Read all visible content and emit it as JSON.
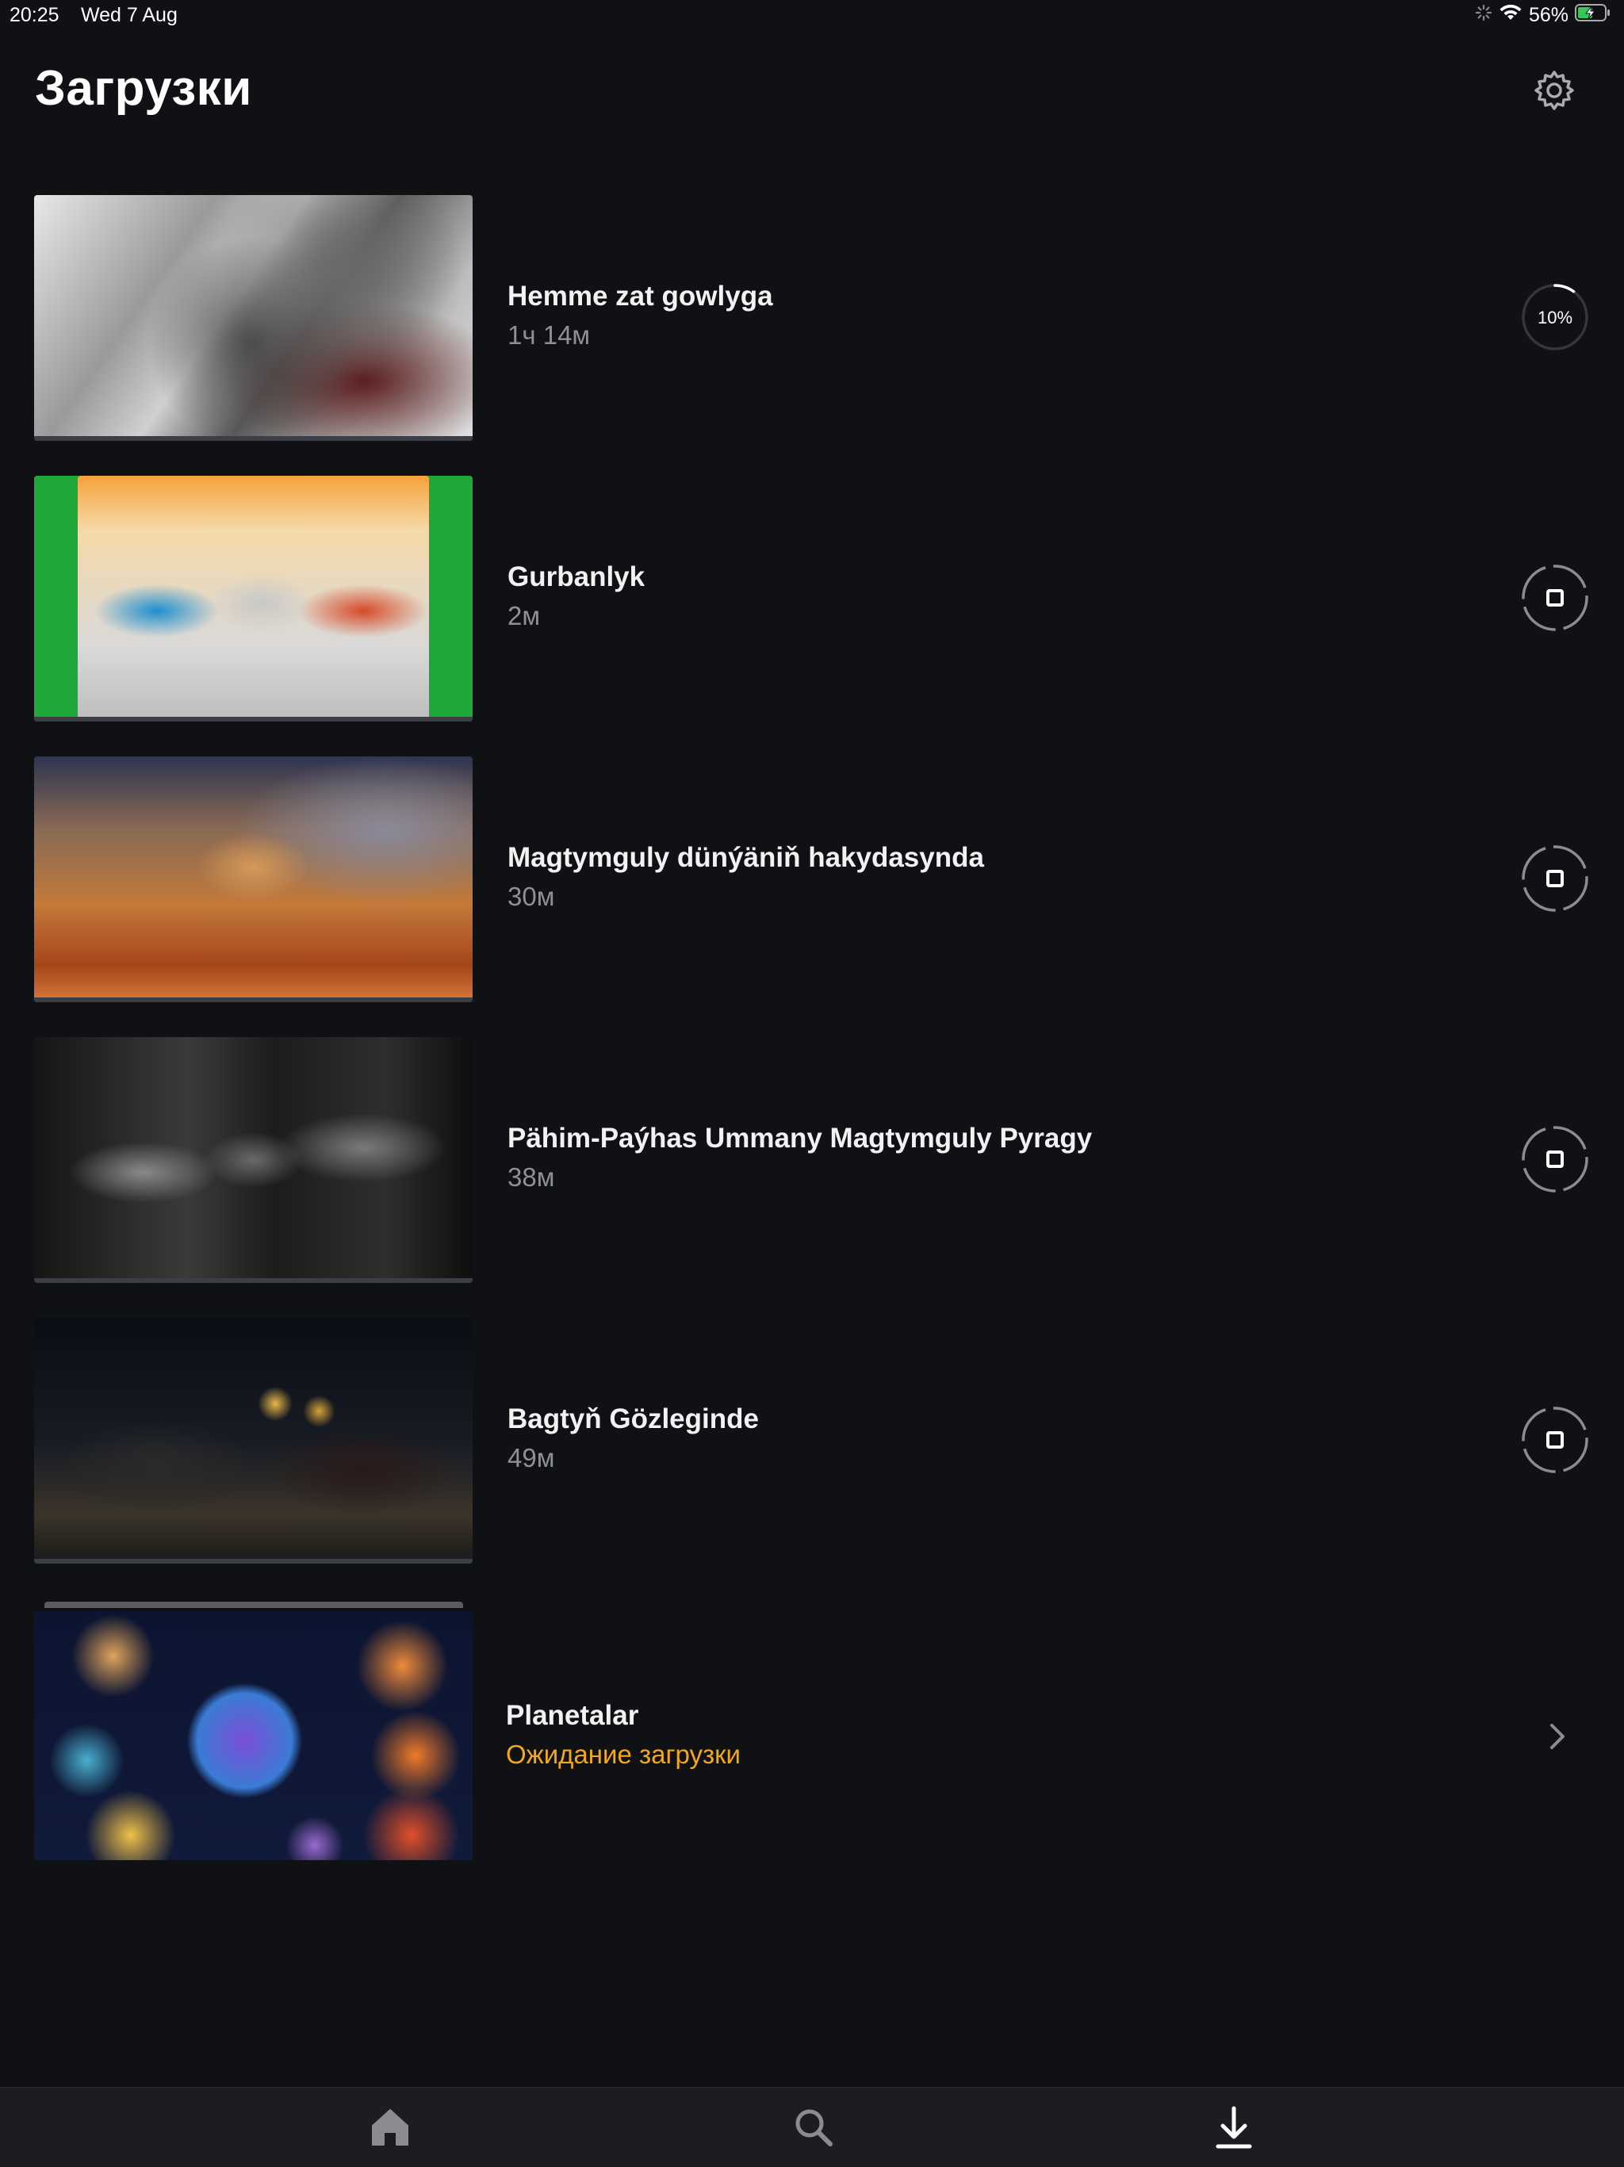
{
  "status_bar": {
    "time": "20:25",
    "date": "Wed 7 Aug",
    "battery": "56%",
    "battery_level": 0.56,
    "icons": [
      "activity-spinner-icon",
      "wifi-icon",
      "battery-charging-icon"
    ]
  },
  "header": {
    "title": "Загрузки",
    "settings_icon": "gear-icon"
  },
  "downloads": [
    {
      "title": "Hemme zat gowlyga",
      "subtitle": "1ч 14м",
      "status": "downloading",
      "progress_label": "10%",
      "progress": 0.1,
      "action_icon": "progress-ring-icon"
    },
    {
      "title": "Gurbanlyk",
      "subtitle": "2м",
      "status": "queued",
      "action_icon": "stop-download-icon"
    },
    {
      "title": "Magtymguly dünýäniň hakydasynda",
      "subtitle": "30м",
      "status": "queued",
      "action_icon": "stop-download-icon"
    },
    {
      "title": "Pähim-Paýhas Ummany Magtymguly Pyragy",
      "subtitle": "38м",
      "status": "queued",
      "action_icon": "stop-download-icon"
    },
    {
      "title": "Bagtyň Gözleginde",
      "subtitle": "49м",
      "status": "queued",
      "action_icon": "stop-download-icon"
    },
    {
      "title": "Planetalar",
      "subtitle": "Ожидание загрузки",
      "status": "waiting",
      "action_icon": "chevron-right-icon"
    }
  ],
  "tab_bar": {
    "tabs": [
      {
        "name": "home",
        "icon": "home-icon",
        "active": false
      },
      {
        "name": "search",
        "icon": "search-icon",
        "active": false
      },
      {
        "name": "downloads",
        "icon": "download-icon",
        "active": true
      }
    ]
  },
  "colors": {
    "background": "#0f1115",
    "subtitle": "#8e9096",
    "waiting": "#f3a71b",
    "tab_bar": "#1c1d21"
  }
}
